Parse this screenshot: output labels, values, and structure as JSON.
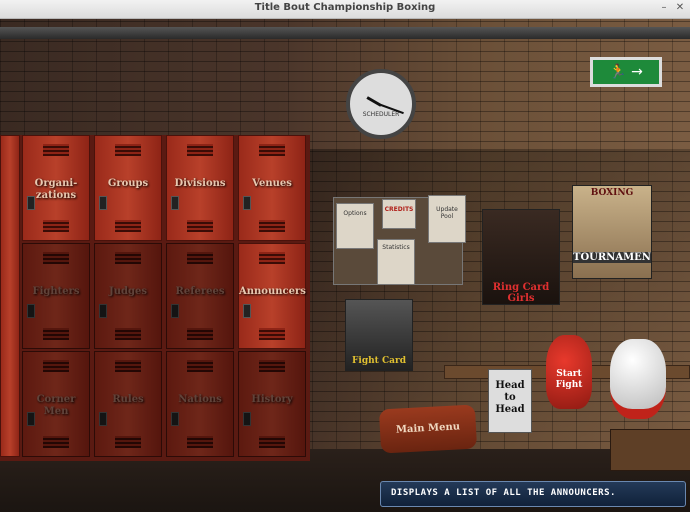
{
  "window": {
    "title": "Title Bout Championship Boxing",
    "min_icon": "minimize-icon",
    "close_icon": "close-icon"
  },
  "lockers": [
    {
      "id": "organizations",
      "label": "Organi-\nzations"
    },
    {
      "id": "groups",
      "label": "Groups"
    },
    {
      "id": "divisions",
      "label": "Divisions"
    },
    {
      "id": "venues",
      "label": "Venues"
    },
    {
      "id": "fighters",
      "label": "Fighters"
    },
    {
      "id": "judges",
      "label": "Judges"
    },
    {
      "id": "referees",
      "label": "Referees"
    },
    {
      "id": "announcers",
      "label": "Announcers"
    },
    {
      "id": "corner-men",
      "label": "Corner Men"
    },
    {
      "id": "rules",
      "label": "Rules"
    },
    {
      "id": "nations",
      "label": "Nations"
    },
    {
      "id": "history",
      "label": "History"
    }
  ],
  "clock": {
    "label": "SCHEDULER"
  },
  "exit_sign": {
    "icon": "exit-running-man-icon",
    "arrow": "→"
  },
  "board": {
    "options": "Options",
    "credits": "CREDITS",
    "update_pool": "Update Pool",
    "statistics": "Statistics"
  },
  "posters": {
    "ring_card_girls": "Ring Card Girls",
    "fight_card": "Fight Card",
    "tournament": "TOURNAMENT",
    "tournament_top": "BOXING"
  },
  "props": {
    "head_to_head": "Head\nto\nHead",
    "start_fight": "Start\nFight",
    "main_menu": "Main Menu"
  },
  "status": {
    "text": "DISPLAYS A LIST OF ALL THE ANNOUNCERS."
  }
}
